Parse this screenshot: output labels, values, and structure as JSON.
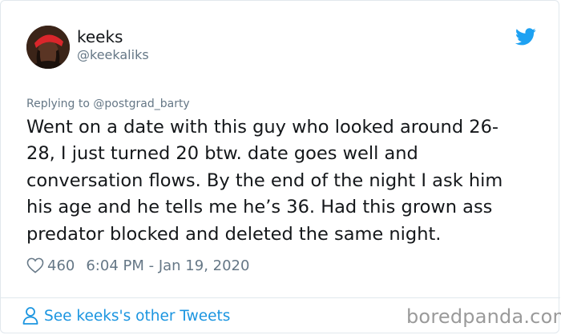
{
  "author": {
    "display_name": "keeks",
    "handle": "@keekaliks",
    "avatar_icon": "profile-photo"
  },
  "brand": {
    "icon": "twitter-bird-icon",
    "color": "#1da1f2"
  },
  "tweet": {
    "replying_to": "Replying to @postgrad_barty",
    "text": "Went on a date with this guy who looked around 26-\n28, I just turned 20 btw. date goes well and\nconversation flows. By the end of the night I ask him\nhis age and he tells me he’s 36. Had this grown ass\npredator blocked and deleted the same night.",
    "likes": "460",
    "timestamp": "6:04 PM - Jan 19, 2020"
  },
  "footer": {
    "see_more_label": "See keeks's other Tweets",
    "link_color": "#1b95e0",
    "watermark": "boredpanda.com"
  }
}
